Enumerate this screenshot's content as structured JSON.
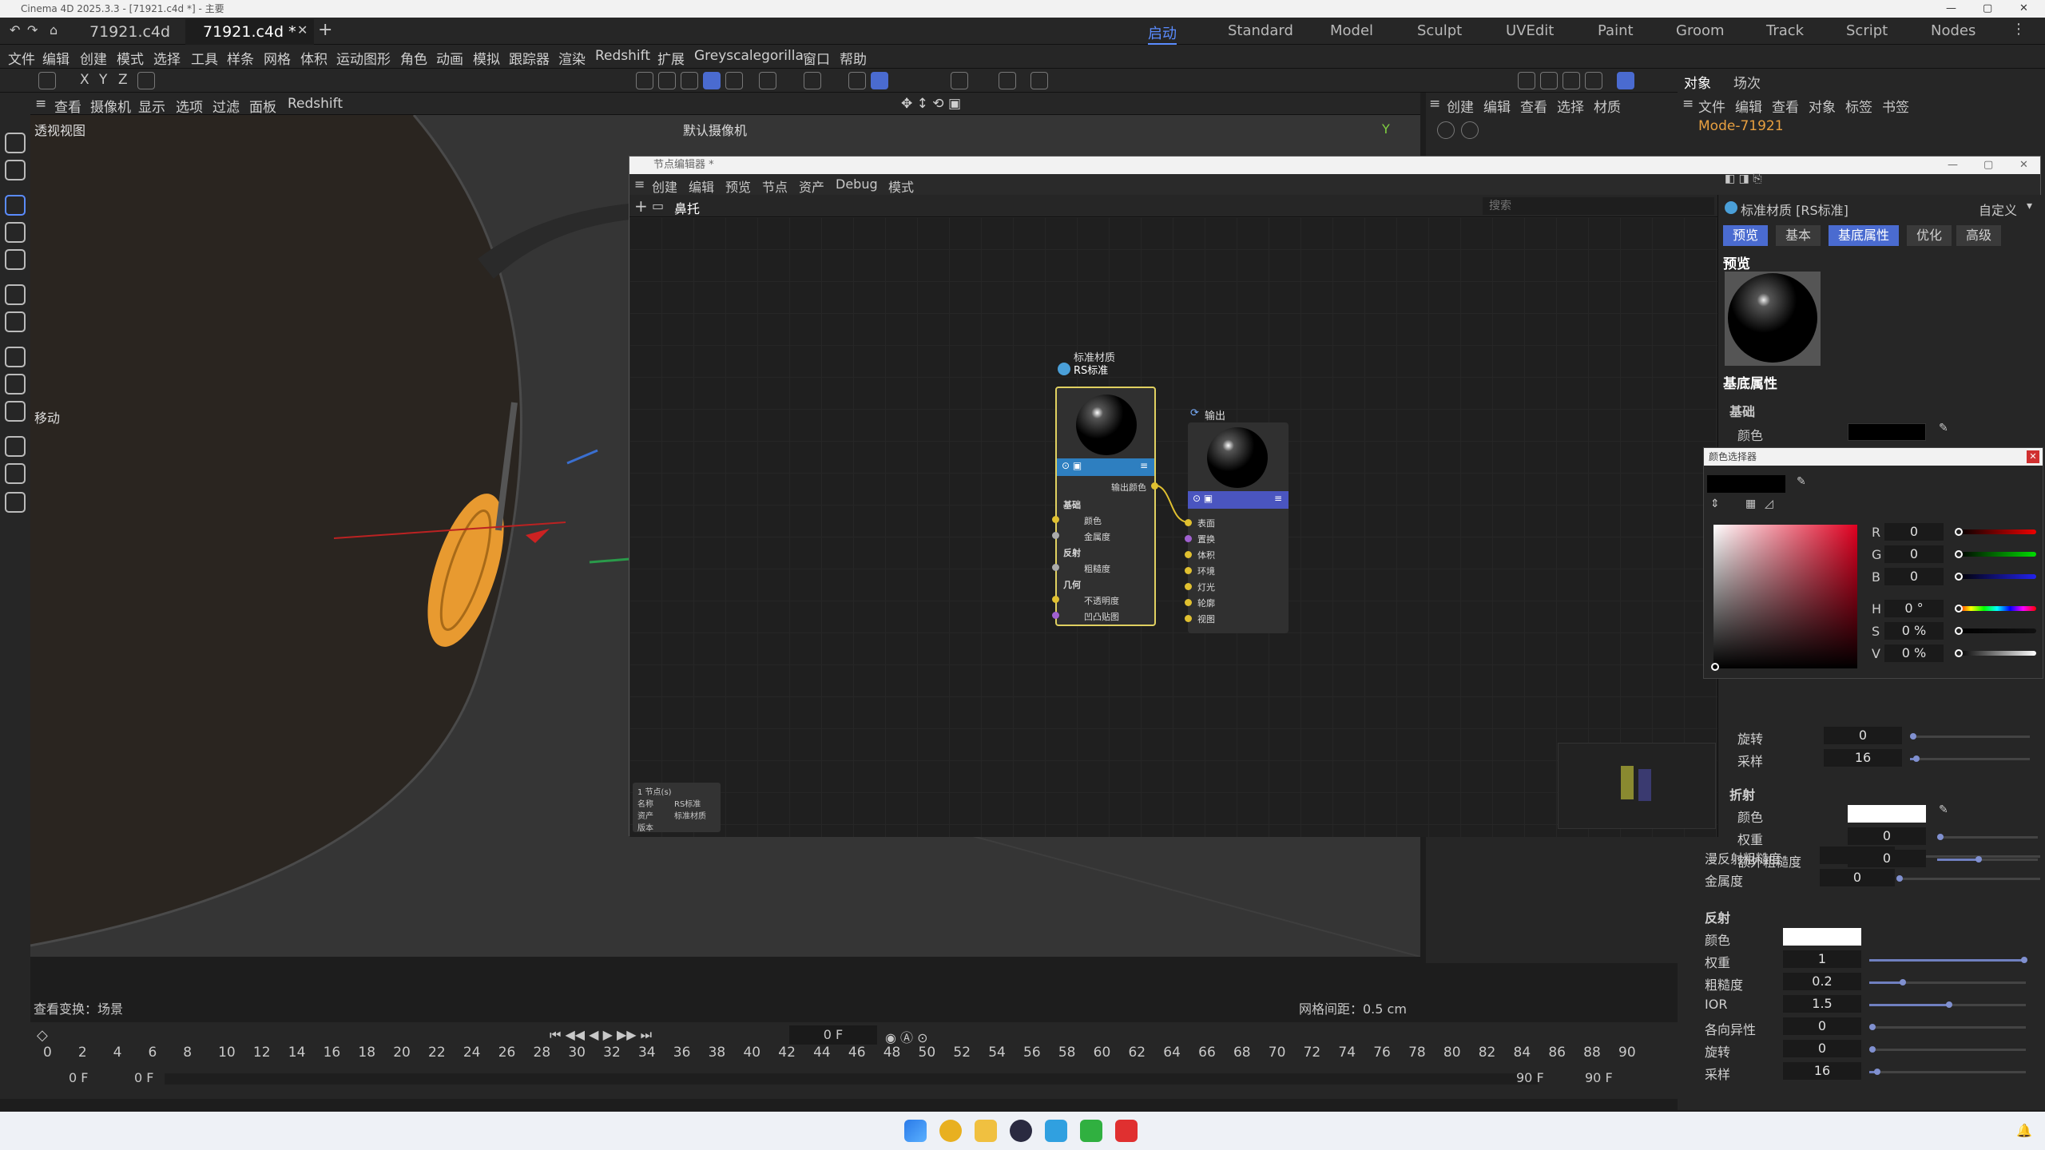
{
  "app": {
    "window_title": "Cinema 4D 2025.3.3 - [71921.c4d *] - 主要"
  },
  "file_tabs": [
    {
      "label": "71921.c4d"
    },
    {
      "label": "71921.c4d *"
    }
  ],
  "layouts": [
    "启动",
    "Standard",
    "Model",
    "Sculpt",
    "UVEdit",
    "Paint",
    "Groom",
    "Track",
    "Script",
    "Nodes"
  ],
  "menu": [
    "文件",
    "编辑",
    "创建",
    "模式",
    "选择",
    "工具",
    "样条",
    "网格",
    "体积",
    "运动图形",
    "角色",
    "动画",
    "模拟",
    "跟踪器",
    "渲染",
    "Redshift",
    "扩展",
    "Greyscalegorilla",
    "窗口",
    "帮助"
  ],
  "axis_buttons": [
    "X",
    "Y",
    "Z"
  ],
  "viewport": {
    "menu": [
      "查看",
      "摄像机",
      "显示",
      "选项",
      "过滤",
      "面板",
      "Redshift"
    ],
    "view_name": "透视视图",
    "camera": "默认摄像机",
    "axis_label": "Y",
    "move_label": "移动",
    "status_left": "查看变换：场景",
    "grid_spacing": "网格间距：0.5 cm"
  },
  "object_panel": {
    "tabs": [
      "对象",
      "场次"
    ],
    "menu": [
      "文件",
      "编辑",
      "查看",
      "对象",
      "标签",
      "书签"
    ],
    "object_name": "Mode-71921"
  },
  "material_panel": {
    "menu": [
      "创建",
      "编辑",
      "查看",
      "选择",
      "材质"
    ]
  },
  "node_editor": {
    "title": "节点编辑器 *",
    "menu": [
      "创建",
      "编辑",
      "预览",
      "节点",
      "资产",
      "Debug",
      "模式"
    ],
    "breadcrumb": "鼻托",
    "search_placeholder": "搜索",
    "material_node": {
      "title": "标准材质",
      "subtitle": "RS标准",
      "output_port": "输出颜色",
      "groups": [
        {
          "name": "基础",
          "ports": [
            "颜色",
            "金属度"
          ]
        },
        {
          "name": "反射",
          "ports": [
            "粗糙度"
          ]
        },
        {
          "name": "几何",
          "ports": [
            "不透明度",
            "凹凸贴图"
          ]
        }
      ]
    },
    "output_node": {
      "title": "输出",
      "ports": [
        "表面",
        "置换",
        "体积",
        "环境",
        "灯光",
        "轮廓",
        "视图"
      ]
    },
    "info": {
      "count": "1 节点(s)",
      "rows": [
        {
          "k": "名称",
          "v": "RS标准"
        },
        {
          "k": "资产",
          "v": "标准材质"
        },
        {
          "k": "版本",
          "v": ""
        }
      ]
    }
  },
  "attributes": {
    "header": "标准材质 [RS标准]",
    "preset": "自定义",
    "tabs": [
      "预览",
      "基本",
      "基底属性",
      "优化",
      "高级"
    ],
    "active_tab": "基底属性",
    "preview_label": "预览",
    "section_title": "基底属性",
    "base_group": "基础",
    "base_color_label": "颜色",
    "rotation_label": "旋转",
    "rotation_value": "0",
    "samples_label": "采样",
    "samples_value": "16",
    "refraction_group": "折射",
    "refr_color_label": "颜色",
    "refr_weight_label": "权重",
    "refr_weight_value": "0",
    "refr_rough_label": "额外粗糙度",
    "refr_rough_value": "0",
    "colors": {
      "base_color": "#000000",
      "refraction_color": "#ffffff"
    }
  },
  "color_picker": {
    "title": "颜色选择器",
    "channels": [
      {
        "label": "R",
        "value": "0"
      },
      {
        "label": "G",
        "value": "0"
      },
      {
        "label": "B",
        "value": "0"
      },
      {
        "label": "H",
        "value": "0 °"
      },
      {
        "label": "S",
        "value": "0 %"
      },
      {
        "label": "V",
        "value": "0 %"
      }
    ]
  },
  "lower_attributes": {
    "diff_rough_label": "漫反射粗糙度",
    "diff_rough_value": "0",
    "metal_label": "金属度",
    "metal_value": "0",
    "reflection_group": "反射",
    "refl_color_label": "颜色",
    "refl_weight_label": "权重",
    "refl_weight_value": "1",
    "refl_rough_label": "粗糙度",
    "refl_rough_value": "0.2",
    "ior_label": "IOR",
    "ior_value": "1.5",
    "aniso_label": "各向异性",
    "aniso_value": "0",
    "refl_rot_label": "旋转",
    "refl_rot_value": "0",
    "refl_samples_label": "采样",
    "refl_samples_value": "16"
  },
  "timeline": {
    "current_frame": "0 F",
    "ticks": [
      "0",
      "2",
      "4",
      "6",
      "8",
      "10",
      "12",
      "14",
      "16",
      "18",
      "20",
      "22",
      "24",
      "26",
      "28",
      "30",
      "32",
      "34",
      "36",
      "38",
      "40",
      "42",
      "44",
      "46",
      "48",
      "50",
      "52",
      "54",
      "56",
      "58",
      "60",
      "62",
      "64",
      "66",
      "68",
      "70",
      "72",
      "74",
      "76",
      "78",
      "80",
      "82",
      "84",
      "86",
      "88",
      "90"
    ],
    "start_a": "0 F",
    "start_b": "0 F",
    "end_a": "90 F",
    "end_b": "90 F"
  }
}
